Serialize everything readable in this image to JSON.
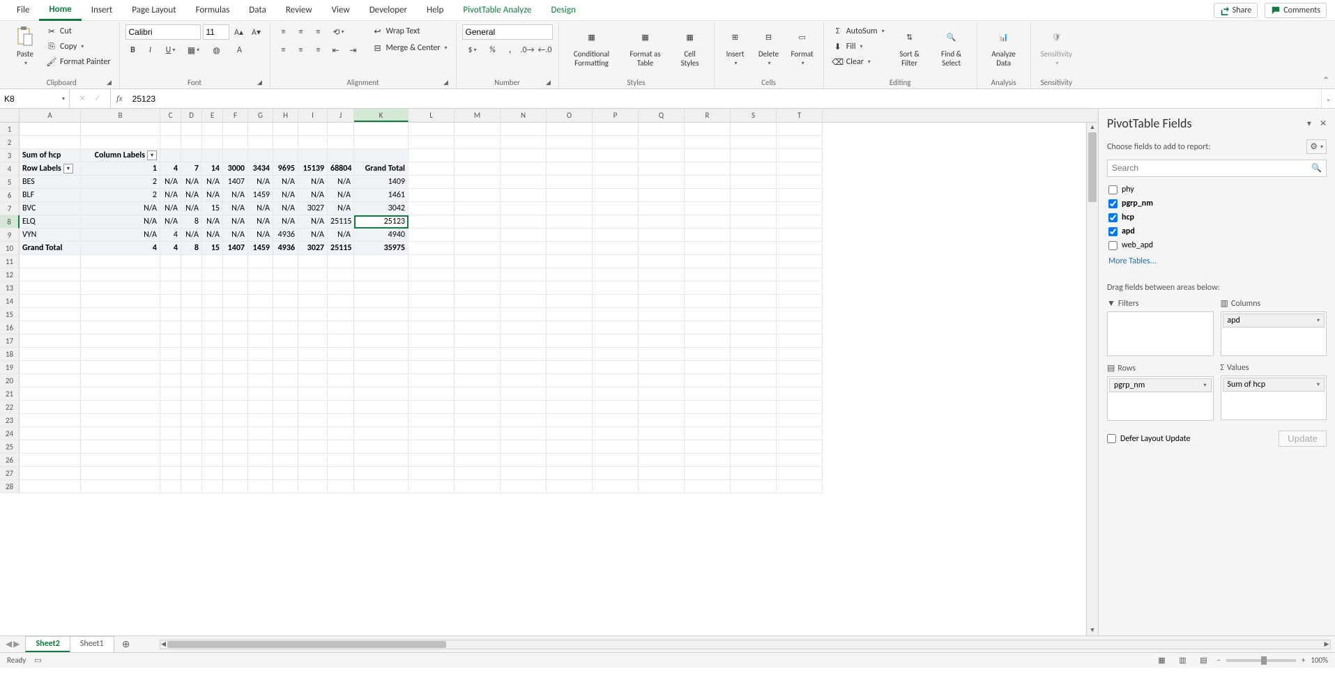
{
  "tabs": [
    "File",
    "Home",
    "Insert",
    "Page Layout",
    "Formulas",
    "Data",
    "Review",
    "View",
    "Developer",
    "Help",
    "PivotTable Analyze",
    "Design"
  ],
  "active_tab": "Home",
  "share": "Share",
  "comments": "Comments",
  "clipboard": {
    "paste": "Paste",
    "cut": "Cut",
    "copy": "Copy",
    "fp": "Format Painter",
    "label": "Clipboard"
  },
  "font": {
    "name": "Calibri",
    "size": "11",
    "label": "Font"
  },
  "alignment": {
    "wrap": "Wrap Text",
    "merge": "Merge & Center",
    "label": "Alignment"
  },
  "number": {
    "format": "General",
    "label": "Number"
  },
  "styles": {
    "cf": "Conditional Formatting",
    "ft": "Format as Table",
    "cs": "Cell Styles",
    "label": "Styles"
  },
  "cells": {
    "ins": "Insert",
    "del": "Delete",
    "fmt": "Format",
    "label": "Cells"
  },
  "editing": {
    "sum": "AutoSum",
    "fill": "Fill",
    "clear": "Clear",
    "sort": "Sort & Filter",
    "find": "Find & Select",
    "label": "Editing"
  },
  "analysis": {
    "analyze": "Analyze Data",
    "label": "Analysis"
  },
  "sensitivity": {
    "sens": "Sensitivity",
    "label": "Sensitivity"
  },
  "name_box": "K8",
  "formula_value": "25123",
  "cols": {
    "A": 88,
    "B": 114,
    "C": 30,
    "D": 30,
    "E": 30,
    "F": 36,
    "G": 36,
    "H": 36,
    "I": 42,
    "J": 38,
    "K": 78,
    "L": 66,
    "M": 66,
    "N": 66,
    "O": 66,
    "P": 66,
    "Q": 66,
    "R": 66,
    "S": 66,
    "T": 66
  },
  "grid": {
    "colLabels": [
      "A",
      "B",
      "C",
      "D",
      "E",
      "F",
      "G",
      "H",
      "I",
      "J",
      "K",
      "L",
      "M",
      "N",
      "O",
      "P",
      "Q",
      "R",
      "S",
      "T"
    ],
    "r3": {
      "A": "Sum of hcp",
      "B": "Column Labels"
    },
    "r4": {
      "A": "Row Labels",
      "B": "1",
      "C": "4",
      "D": "7",
      "E": "14",
      "F": "3000",
      "G": "3434",
      "H": "9695",
      "I": "15139",
      "J": "68804",
      "K": "Grand Total"
    },
    "r5": {
      "A": "BES",
      "B": "2",
      "C": "N/A",
      "D": "N/A",
      "E": "N/A",
      "F": "1407",
      "G": "N/A",
      "H": "N/A",
      "I": "N/A",
      "J": "N/A",
      "K": "1409"
    },
    "r6": {
      "A": "BLF",
      "B": "2",
      "C": "N/A",
      "D": "N/A",
      "E": "N/A",
      "F": "N/A",
      "G": "1459",
      "H": "N/A",
      "I": "N/A",
      "J": "N/A",
      "K": "1461"
    },
    "r7": {
      "A": "BVC",
      "B": "N/A",
      "C": "N/A",
      "D": "N/A",
      "E": "15",
      "F": "N/A",
      "G": "N/A",
      "H": "N/A",
      "I": "3027",
      "J": "N/A",
      "K": "3042"
    },
    "r8": {
      "A": "ELQ",
      "B": "N/A",
      "C": "N/A",
      "D": "8",
      "E": "N/A",
      "F": "N/A",
      "G": "N/A",
      "H": "N/A",
      "I": "N/A",
      "J": "25115",
      "K": "25123"
    },
    "r9": {
      "A": "VYN",
      "B": "N/A",
      "C": "4",
      "D": "N/A",
      "E": "N/A",
      "F": "N/A",
      "G": "N/A",
      "H": "4936",
      "I": "N/A",
      "J": "N/A",
      "K": "4940"
    },
    "r10": {
      "A": "Grand Total",
      "B": "4",
      "C": "4",
      "D": "8",
      "E": "15",
      "F": "1407",
      "G": "1459",
      "H": "4936",
      "I": "3027",
      "J": "25115",
      "K": "35975"
    }
  },
  "sheets": [
    "Sheet2",
    "Sheet1"
  ],
  "active_sheet": "Sheet2",
  "pivot": {
    "title": "PivotTable Fields",
    "choose": "Choose fields to add to report:",
    "search_ph": "Search",
    "fields": [
      {
        "name": "phy",
        "checked": false
      },
      {
        "name": "pgrp_nm",
        "checked": true
      },
      {
        "name": "hcp",
        "checked": true
      },
      {
        "name": "apd",
        "checked": true
      },
      {
        "name": "web_apd",
        "checked": false
      }
    ],
    "more": "More Tables...",
    "drag": "Drag fields between areas below:",
    "areas": {
      "filters": {
        "title": "Filters",
        "items": []
      },
      "columns": {
        "title": "Columns",
        "items": [
          "apd"
        ]
      },
      "rows": {
        "title": "Rows",
        "items": [
          "pgrp_nm"
        ]
      },
      "values": {
        "title": "Values",
        "items": [
          "Sum of hcp"
        ]
      }
    },
    "defer": "Defer Layout Update",
    "update": "Update"
  },
  "status": {
    "ready": "Ready",
    "zoom": "100%"
  }
}
